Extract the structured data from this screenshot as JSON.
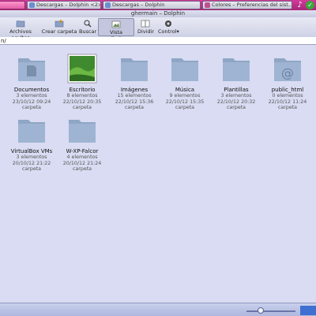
{
  "taskbar": {
    "tasks": [
      {
        "label": ""
      },
      {
        "label": "Descargas – Dolphin <2>"
      },
      {
        "label": "Descargas – Dolphin"
      },
      {
        "label": "Colores – Preferencias del sist..."
      }
    ]
  },
  "window": {
    "title": "ghermain – Dolphin"
  },
  "toolbar": {
    "hidden_files": "Archivos ocultos",
    "create_folder": "Crear carpeta",
    "search": "Buscar",
    "preview": "Vista preliminar",
    "split": "Dividir",
    "control": "Control"
  },
  "location": {
    "path": "n/"
  },
  "files": [
    {
      "name": "Documentos",
      "count": "3 elementos",
      "date": "23/10/12 09:24",
      "type": "carpeta",
      "icon": "folder-documents-icon"
    },
    {
      "name": "Escritorio",
      "count": "8 elementos",
      "date": "22/10/12 20:35",
      "type": "carpeta",
      "icon": "desktop-thumbnail"
    },
    {
      "name": "Imágenes",
      "count": "15 elementos",
      "date": "22/10/12 15:36",
      "type": "carpeta",
      "icon": "folder-icon"
    },
    {
      "name": "Música",
      "count": "9 elementos",
      "date": "22/10/12 15:35",
      "type": "carpeta",
      "icon": "folder-icon"
    },
    {
      "name": "Plantillas",
      "count": "3 elementos",
      "date": "22/10/12 20:32",
      "type": "carpeta",
      "icon": "folder-icon"
    },
    {
      "name": "public_html",
      "count": "0 elementos",
      "date": "22/10/12 11:24",
      "type": "carpeta",
      "icon": "folder-html-icon"
    },
    {
      "name": "VirtualBox VMs",
      "count": "3 elementos",
      "date": "20/10/12 21:22",
      "type": "carpeta",
      "icon": "folder-icon"
    },
    {
      "name": "W-XP-Falcor",
      "count": "4 elementos",
      "date": "20/10/12 21:24",
      "type": "carpeta",
      "icon": "folder-icon"
    }
  ],
  "colors": {
    "folder": "#8fa6c6",
    "taskbar": "#c2307f",
    "background": "#d9dcf2"
  }
}
